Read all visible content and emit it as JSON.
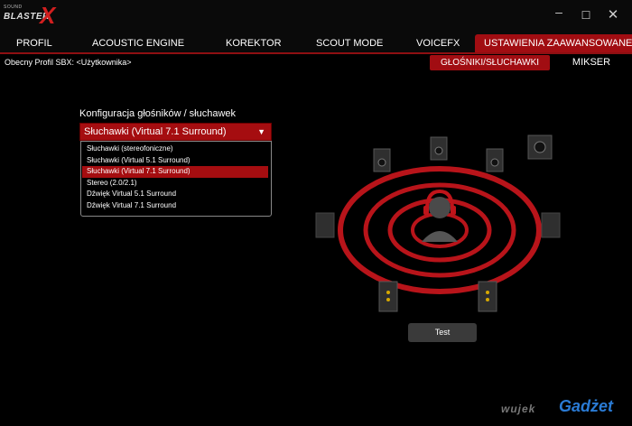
{
  "window": {
    "logo_small": "SOUND",
    "logo_text": "BLASTER",
    "logo_mark": "X",
    "controls": {
      "minimize": "–",
      "maximize": "☐",
      "close": "✕"
    }
  },
  "nav": {
    "tabs": [
      {
        "label": "PROFIL",
        "active": false
      },
      {
        "label": "ACOUSTIC ENGINE",
        "active": false
      },
      {
        "label": "KOREKTOR",
        "active": false
      },
      {
        "label": "SCOUT MODE",
        "active": false
      },
      {
        "label": "VOICEFX",
        "active": false
      },
      {
        "label": "USTAWIENIA ZAAWANSOWANE",
        "active": true
      }
    ]
  },
  "profile": {
    "text": "Obecny Profil SBX: <Użytkownika>"
  },
  "subtabs": [
    {
      "label": "GŁOŚNIKI/SŁUCHAWKI",
      "active": true
    },
    {
      "label": "MIKSER",
      "active": false
    }
  ],
  "config": {
    "label": "Konfiguracja głośników / słuchawek",
    "selected": "Słuchawki (Virtual 7.1 Surround)",
    "options": [
      "Słuchawki (stereofoniczne)",
      "Słuchawki (Virtual 5.1 Surround)",
      "Słuchawki (Virtual 7.1 Surround)",
      "Stereo (2.0/2.1)",
      "Dźwięk Virtual 5.1 Surround",
      "Dźwięk Virtual 7.1 Surround"
    ],
    "selected_index": 2
  },
  "test_button": "Test",
  "watermark": {
    "prefix": "wujek",
    "brand": "Gadżet"
  },
  "colors": {
    "accent": "#a10d12",
    "background": "#000000",
    "ring": "#b8141a"
  },
  "icons": {
    "listener": "headphones-user-icon",
    "speaker": "speaker-icon",
    "dropdown": "chevron-down-icon"
  }
}
